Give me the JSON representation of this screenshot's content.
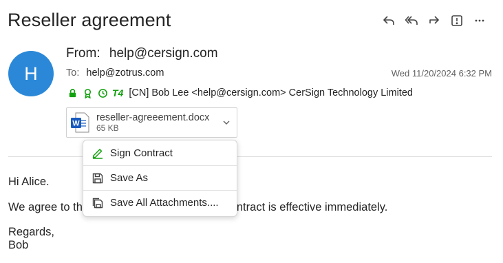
{
  "email": {
    "subject": "Reseller agreement",
    "avatar_initial": "H",
    "from_label": "From:",
    "from_address": "help@cersign.com",
    "to_label": "To:",
    "to_address": "help@zotrus.com",
    "date": "Wed 11/20/2024 6:32 PM",
    "cert_t4_label": "T4",
    "cert_text": "[CN] Bob Lee <help@cersign.com> CerSign Technology Limited"
  },
  "actions": [
    {
      "icon": "reply-icon"
    },
    {
      "icon": "reply-all-icon"
    },
    {
      "icon": "forward-icon"
    },
    {
      "icon": "importance-icon"
    },
    {
      "icon": "more-icon"
    }
  ],
  "attachment": {
    "file_name": "reseller-agreeement.docx",
    "file_size": "65 KB",
    "icon": "word-doc-icon"
  },
  "context_menu": {
    "items": [
      {
        "label": "Sign Contract",
        "icon": "sign-icon"
      },
      {
        "label": "Save As",
        "icon": "save-icon"
      },
      {
        "label": "Save All Attachments....",
        "icon": "save-all-icon"
      }
    ]
  },
  "body": {
    "greeting": "Hi Alice.",
    "line_visible_start": "We agree to th",
    "line_visible_end": "the contract is effective immediately.",
    "closing": "Regards,",
    "signature": "Bob"
  },
  "colors": {
    "avatar": "#2b88d8",
    "cert_green": "#13a10e",
    "word_blue": "#185abd"
  }
}
